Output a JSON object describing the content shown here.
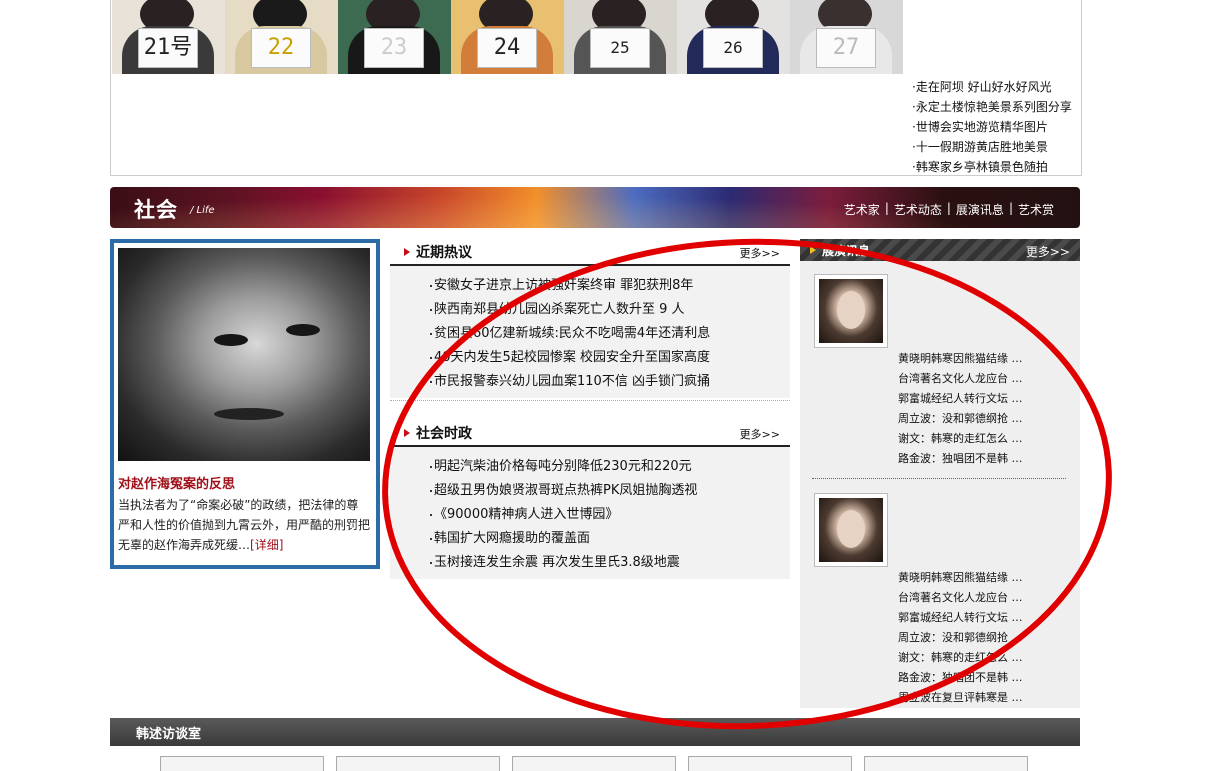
{
  "photostrip": {
    "cards": [
      "21号",
      "22",
      "23",
      "24",
      "25",
      "26",
      "27"
    ]
  },
  "top_news": [
    "·走在阿坝 好山好水好风光",
    "·永定土楼惊艳美景系列图分享",
    "·世博会实地游览精华图片",
    "·十一假期游黄店胜地美景",
    "·韩寒家乡亭林镇景色随拍"
  ],
  "banner": {
    "title": "社会",
    "subtitle": "/ Life",
    "nav": [
      "艺术家",
      "艺术动态",
      "展演讯息",
      "艺术赏"
    ]
  },
  "feature": {
    "title": "对赵作海冤案的反思",
    "text": "当执法者为了“命案必破”的政绩，把法律的尊严和人性的价值抛到九霄云外，用严酷的刑罚把无辜的赵作海弄成死缓…",
    "more": "[详细]"
  },
  "recent": {
    "title": "近期热议",
    "more": "更多>>",
    "items": [
      "安徽女子进京上访被强奸案终审 罪犯获刑8年",
      "陕西南郑县幼儿园凶杀案死亡人数升至 9 人",
      "贫困县60亿建新城续:民众不吃喝需4年还清利息",
      "40天内发生5起校园惨案 校园安全升至国家高度",
      "市民报警泰兴幼儿园血案110不信 凶手锁门疯捅"
    ]
  },
  "politics": {
    "title": "社会时政",
    "more": "更多>>",
    "items": [
      "明起汽柴油价格每吨分别降低230元和220元",
      "超级丑男伪娘贤淑哥斑点热裤PK凤姐抛胸透视",
      "《90000精神病人进入世博园》",
      "韩国扩大网瘾援助的覆盖面",
      "玉树接连发生余震 再次发生里氏3.8级地震"
    ]
  },
  "right": {
    "title": "展演讯息",
    "more": "更多>>",
    "block1": [
      "黄晓明韩寒因熊猫结缘 …",
      "台湾著名文化人龙应台 …",
      "郭富城经纪人转行文坛 …",
      "周立波：没和郭德纲抢 …",
      "谢文：韩寒的走红怎么 …",
      "路金波：独唱团不是韩 …"
    ],
    "block2": [
      "黄晓明韩寒因熊猫结缘 …",
      "台湾著名文化人龙应台 …",
      "郭富城经纪人转行文坛 …",
      "周立波：没和郭德纲抢 …",
      "谢文：韩寒的走红怎么 …",
      "路金波：独唱团不是韩 …",
      "周立波在复旦评韩寒是 …"
    ]
  },
  "bottom": {
    "title": "韩述访谈室",
    "tabs": [
      "",
      "",
      "",
      "",
      ""
    ]
  },
  "colors": {
    "accent": "#c80b16",
    "feature_border": "#2b6ba6",
    "oval": "#e00000"
  }
}
